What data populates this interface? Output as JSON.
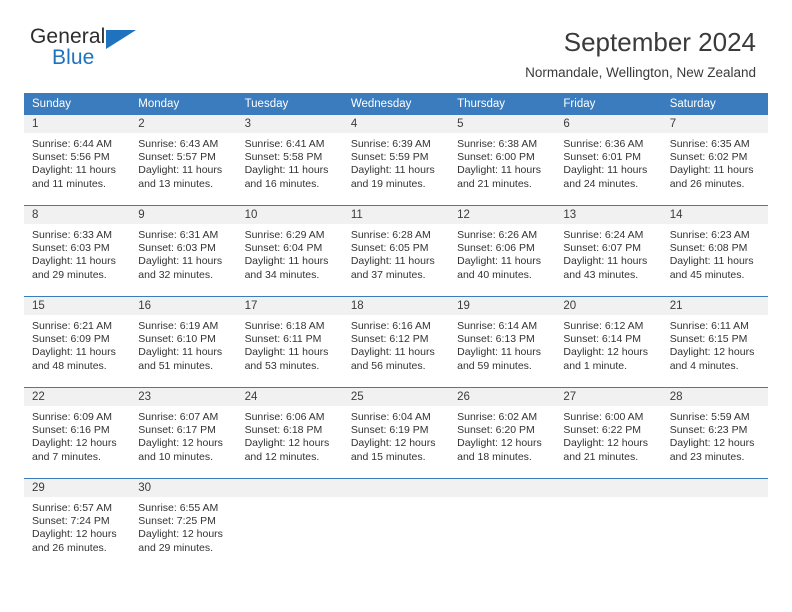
{
  "brand": {
    "name_top": "General",
    "name_bottom": "Blue",
    "triangle_color": "#1f72bd"
  },
  "header": {
    "title": "September 2024",
    "subtitle": "Normandale, Wellington, New Zealand"
  },
  "theme": {
    "header_bg": "#3a7cbe",
    "header_text": "#ffffff",
    "day_band_bg": "#f1f1f1",
    "row_border": "#3a7cbe"
  },
  "calendar": {
    "weekdays": [
      "Sunday",
      "Monday",
      "Tuesday",
      "Wednesday",
      "Thursday",
      "Friday",
      "Saturday"
    ],
    "weeks": [
      [
        {
          "day": "1",
          "sunrise": "Sunrise: 6:44 AM",
          "sunset": "Sunset: 5:56 PM",
          "daylight_1": "Daylight: 11 hours",
          "daylight_2": "and 11 minutes."
        },
        {
          "day": "2",
          "sunrise": "Sunrise: 6:43 AM",
          "sunset": "Sunset: 5:57 PM",
          "daylight_1": "Daylight: 11 hours",
          "daylight_2": "and 13 minutes."
        },
        {
          "day": "3",
          "sunrise": "Sunrise: 6:41 AM",
          "sunset": "Sunset: 5:58 PM",
          "daylight_1": "Daylight: 11 hours",
          "daylight_2": "and 16 minutes."
        },
        {
          "day": "4",
          "sunrise": "Sunrise: 6:39 AM",
          "sunset": "Sunset: 5:59 PM",
          "daylight_1": "Daylight: 11 hours",
          "daylight_2": "and 19 minutes."
        },
        {
          "day": "5",
          "sunrise": "Sunrise: 6:38 AM",
          "sunset": "Sunset: 6:00 PM",
          "daylight_1": "Daylight: 11 hours",
          "daylight_2": "and 21 minutes."
        },
        {
          "day": "6",
          "sunrise": "Sunrise: 6:36 AM",
          "sunset": "Sunset: 6:01 PM",
          "daylight_1": "Daylight: 11 hours",
          "daylight_2": "and 24 minutes."
        },
        {
          "day": "7",
          "sunrise": "Sunrise: 6:35 AM",
          "sunset": "Sunset: 6:02 PM",
          "daylight_1": "Daylight: 11 hours",
          "daylight_2": "and 26 minutes."
        }
      ],
      [
        {
          "day": "8",
          "sunrise": "Sunrise: 6:33 AM",
          "sunset": "Sunset: 6:03 PM",
          "daylight_1": "Daylight: 11 hours",
          "daylight_2": "and 29 minutes."
        },
        {
          "day": "9",
          "sunrise": "Sunrise: 6:31 AM",
          "sunset": "Sunset: 6:03 PM",
          "daylight_1": "Daylight: 11 hours",
          "daylight_2": "and 32 minutes."
        },
        {
          "day": "10",
          "sunrise": "Sunrise: 6:29 AM",
          "sunset": "Sunset: 6:04 PM",
          "daylight_1": "Daylight: 11 hours",
          "daylight_2": "and 34 minutes."
        },
        {
          "day": "11",
          "sunrise": "Sunrise: 6:28 AM",
          "sunset": "Sunset: 6:05 PM",
          "daylight_1": "Daylight: 11 hours",
          "daylight_2": "and 37 minutes."
        },
        {
          "day": "12",
          "sunrise": "Sunrise: 6:26 AM",
          "sunset": "Sunset: 6:06 PM",
          "daylight_1": "Daylight: 11 hours",
          "daylight_2": "and 40 minutes."
        },
        {
          "day": "13",
          "sunrise": "Sunrise: 6:24 AM",
          "sunset": "Sunset: 6:07 PM",
          "daylight_1": "Daylight: 11 hours",
          "daylight_2": "and 43 minutes."
        },
        {
          "day": "14",
          "sunrise": "Sunrise: 6:23 AM",
          "sunset": "Sunset: 6:08 PM",
          "daylight_1": "Daylight: 11 hours",
          "daylight_2": "and 45 minutes."
        }
      ],
      [
        {
          "day": "15",
          "sunrise": "Sunrise: 6:21 AM",
          "sunset": "Sunset: 6:09 PM",
          "daylight_1": "Daylight: 11 hours",
          "daylight_2": "and 48 minutes."
        },
        {
          "day": "16",
          "sunrise": "Sunrise: 6:19 AM",
          "sunset": "Sunset: 6:10 PM",
          "daylight_1": "Daylight: 11 hours",
          "daylight_2": "and 51 minutes."
        },
        {
          "day": "17",
          "sunrise": "Sunrise: 6:18 AM",
          "sunset": "Sunset: 6:11 PM",
          "daylight_1": "Daylight: 11 hours",
          "daylight_2": "and 53 minutes."
        },
        {
          "day": "18",
          "sunrise": "Sunrise: 6:16 AM",
          "sunset": "Sunset: 6:12 PM",
          "daylight_1": "Daylight: 11 hours",
          "daylight_2": "and 56 minutes."
        },
        {
          "day": "19",
          "sunrise": "Sunrise: 6:14 AM",
          "sunset": "Sunset: 6:13 PM",
          "daylight_1": "Daylight: 11 hours",
          "daylight_2": "and 59 minutes."
        },
        {
          "day": "20",
          "sunrise": "Sunrise: 6:12 AM",
          "sunset": "Sunset: 6:14 PM",
          "daylight_1": "Daylight: 12 hours",
          "daylight_2": "and 1 minute."
        },
        {
          "day": "21",
          "sunrise": "Sunrise: 6:11 AM",
          "sunset": "Sunset: 6:15 PM",
          "daylight_1": "Daylight: 12 hours",
          "daylight_2": "and 4 minutes."
        }
      ],
      [
        {
          "day": "22",
          "sunrise": "Sunrise: 6:09 AM",
          "sunset": "Sunset: 6:16 PM",
          "daylight_1": "Daylight: 12 hours",
          "daylight_2": "and 7 minutes."
        },
        {
          "day": "23",
          "sunrise": "Sunrise: 6:07 AM",
          "sunset": "Sunset: 6:17 PM",
          "daylight_1": "Daylight: 12 hours",
          "daylight_2": "and 10 minutes."
        },
        {
          "day": "24",
          "sunrise": "Sunrise: 6:06 AM",
          "sunset": "Sunset: 6:18 PM",
          "daylight_1": "Daylight: 12 hours",
          "daylight_2": "and 12 minutes."
        },
        {
          "day": "25",
          "sunrise": "Sunrise: 6:04 AM",
          "sunset": "Sunset: 6:19 PM",
          "daylight_1": "Daylight: 12 hours",
          "daylight_2": "and 15 minutes."
        },
        {
          "day": "26",
          "sunrise": "Sunrise: 6:02 AM",
          "sunset": "Sunset: 6:20 PM",
          "daylight_1": "Daylight: 12 hours",
          "daylight_2": "and 18 minutes."
        },
        {
          "day": "27",
          "sunrise": "Sunrise: 6:00 AM",
          "sunset": "Sunset: 6:22 PM",
          "daylight_1": "Daylight: 12 hours",
          "daylight_2": "and 21 minutes."
        },
        {
          "day": "28",
          "sunrise": "Sunrise: 5:59 AM",
          "sunset": "Sunset: 6:23 PM",
          "daylight_1": "Daylight: 12 hours",
          "daylight_2": "and 23 minutes."
        }
      ],
      [
        {
          "day": "29",
          "sunrise": "Sunrise: 6:57 AM",
          "sunset": "Sunset: 7:24 PM",
          "daylight_1": "Daylight: 12 hours",
          "daylight_2": "and 26 minutes."
        },
        {
          "day": "30",
          "sunrise": "Sunrise: 6:55 AM",
          "sunset": "Sunset: 7:25 PM",
          "daylight_1": "Daylight: 12 hours",
          "daylight_2": "and 29 minutes."
        },
        {
          "day": "",
          "sunrise": "",
          "sunset": "",
          "daylight_1": "",
          "daylight_2": ""
        },
        {
          "day": "",
          "sunrise": "",
          "sunset": "",
          "daylight_1": "",
          "daylight_2": ""
        },
        {
          "day": "",
          "sunrise": "",
          "sunset": "",
          "daylight_1": "",
          "daylight_2": ""
        },
        {
          "day": "",
          "sunrise": "",
          "sunset": "",
          "daylight_1": "",
          "daylight_2": ""
        },
        {
          "day": "",
          "sunrise": "",
          "sunset": "",
          "daylight_1": "",
          "daylight_2": ""
        }
      ]
    ]
  }
}
